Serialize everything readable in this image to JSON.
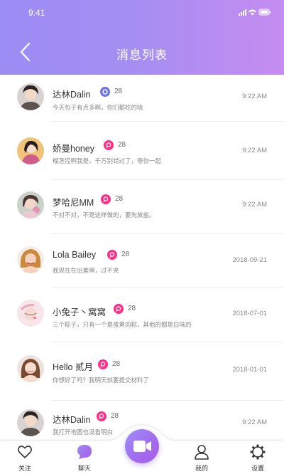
{
  "status_bar": {
    "time": "9:41"
  },
  "header": {
    "title": "消息列表"
  },
  "colors": {
    "header_start": "#9b8cf4",
    "header_end": "#c58cf0",
    "badge_blue": "#6b73e6",
    "badge_pink": "#ff2e86",
    "accent_purple": "#a070f0"
  },
  "messages": [
    {
      "name": "达林Dalin",
      "count": "28",
      "preview": "今天包子有点多啊，你们都吃的啥",
      "time": "9:22 AM",
      "badge": "blue",
      "avatar": "person-a"
    },
    {
      "name": "娇曼honey",
      "count": "28",
      "preview": "榴莲控啊我是，千万别错过了，等你一起",
      "time": "9:22 AM",
      "badge": "pink",
      "avatar": "person-b"
    },
    {
      "name": "梦哈尼MM",
      "count": "28",
      "preview": "不对不对，不是这样做的，要先放盐。",
      "time": "9:22 AM",
      "badge": "pink",
      "avatar": "person-c"
    },
    {
      "name": "Lola Bailey",
      "count": "28",
      "preview": "我现在在出差啊，过不来",
      "time": "2018-09-21",
      "badge": "pink",
      "avatar": "person-d"
    },
    {
      "name": "小兔子丶窝窝",
      "count": "28",
      "preview": "三个粽子，只有一个是蛋黄肉粽，其他的都是白味的",
      "time": "2018-07-01",
      "badge": "pink",
      "avatar": "person-e"
    },
    {
      "name": "Hello 贰月",
      "count": "28",
      "preview": "你想好了吗？我明天就要提交材料了",
      "time": "2018-01-01",
      "badge": "pink",
      "avatar": "person-f"
    },
    {
      "name": "达林Dalin",
      "count": "28",
      "preview": "我打开地图也没看明白",
      "time": "9:22 AM",
      "badge": "pink",
      "avatar": "person-a"
    }
  ],
  "tabbar": {
    "tabs": [
      {
        "label": "关注",
        "icon": "heart-icon",
        "active": false
      },
      {
        "label": "聊天",
        "icon": "chat-bubble-icon",
        "active": true
      },
      {
        "label": "我的",
        "icon": "user-icon",
        "active": false
      },
      {
        "label": "设置",
        "icon": "gear-icon",
        "active": false
      }
    ],
    "center": {
      "icon": "video-camera-icon"
    }
  }
}
